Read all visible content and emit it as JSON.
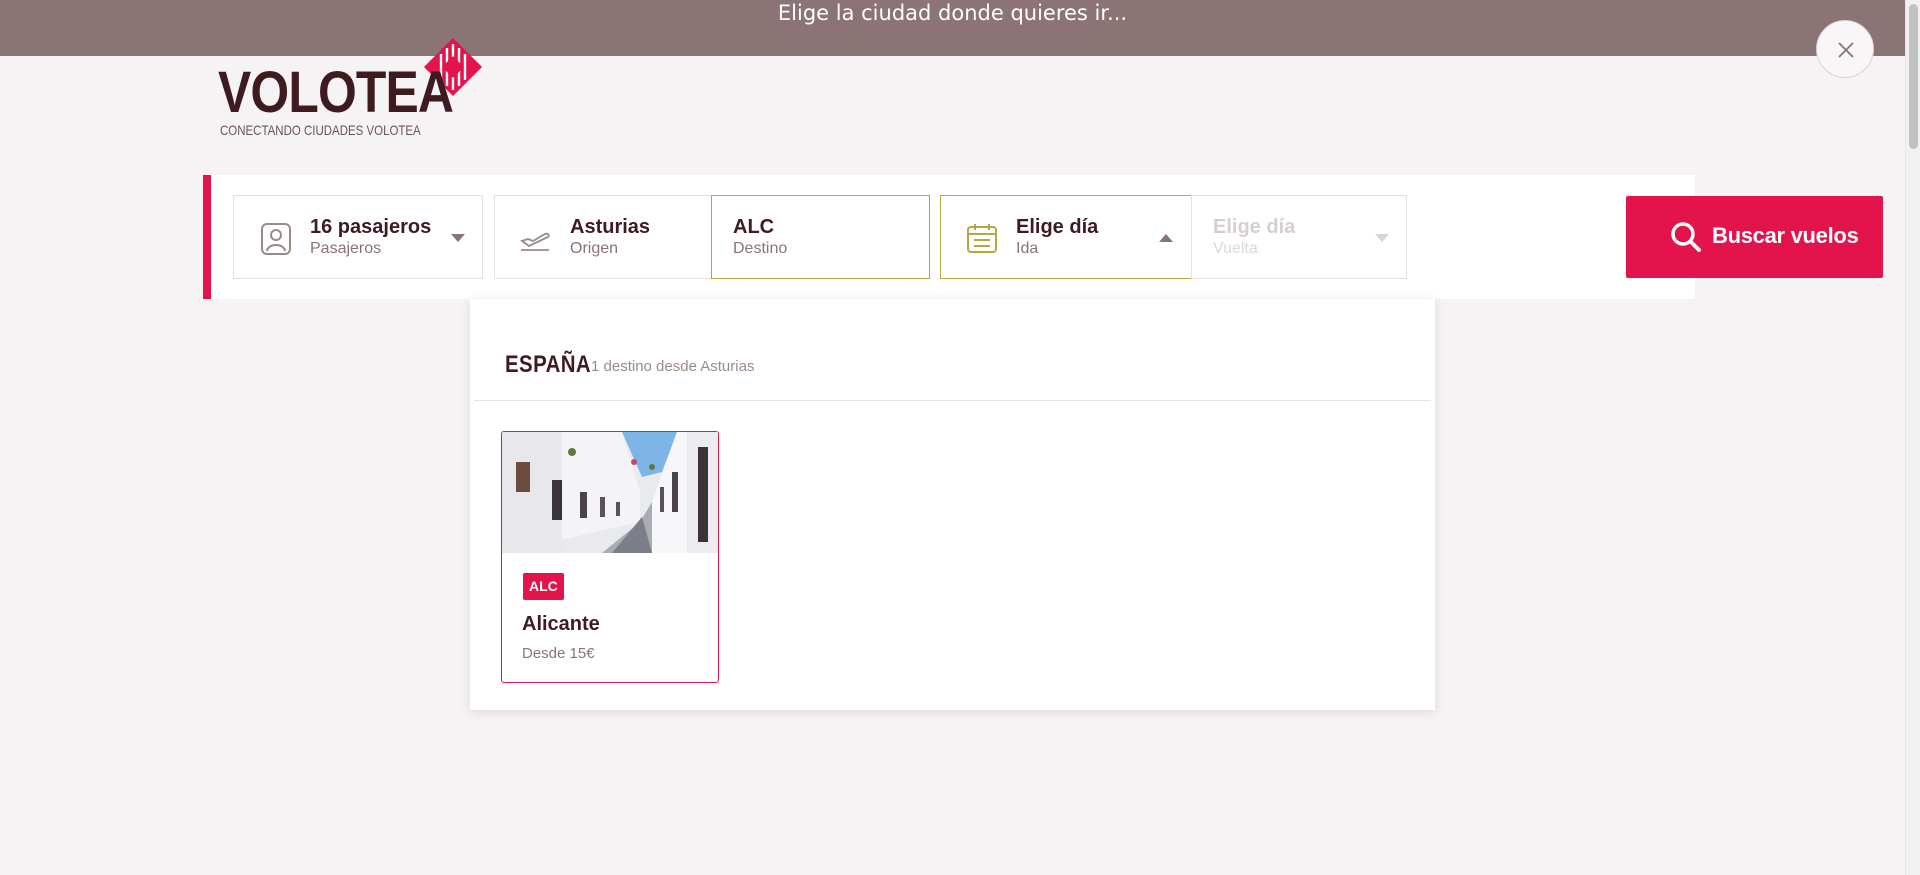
{
  "banner": {
    "text": "Elige la ciudad donde quieres ir..."
  },
  "close": {
    "icon": "close-icon"
  },
  "logo": {
    "word": "VOLOTEA",
    "tagline": "CONECTANDO CIUDADES VOLOTEA"
  },
  "colors": {
    "brand_red": "#e3134b",
    "brand_dark": "#3d1b21",
    "banner_bg": "#8b7376",
    "active_border": "#b6a742",
    "page_bg": "#f6f3f4"
  },
  "search": {
    "passengers": {
      "value": "16 pasajeros",
      "label": "Pasajeros",
      "icon": "passengers-icon"
    },
    "origin": {
      "value": "Asturias",
      "label": "Origen",
      "icon": "plane-takeoff-icon"
    },
    "destination": {
      "value": "ALC",
      "label": "Destino"
    },
    "outbound": {
      "value": "Elige día",
      "label": "Ida",
      "icon": "calendar-icon"
    },
    "return": {
      "value": "Elige día",
      "label": "Vuelta"
    },
    "button_label": "Buscar vuelos"
  },
  "results": {
    "country": "ESPAÑA",
    "subtitle": "1 destino desde Asturias",
    "destinations": [
      {
        "code": "ALC",
        "name": "Alicante",
        "price": "Desde 15€"
      }
    ]
  }
}
